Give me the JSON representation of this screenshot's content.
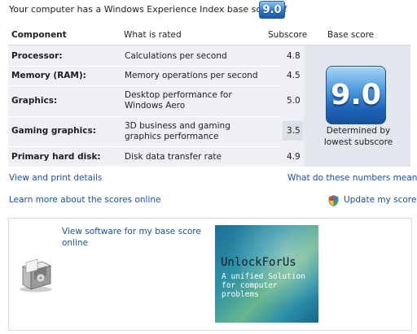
{
  "header": {
    "text": "Your computer has a Windows Experience Index base score of",
    "badge": "9.0"
  },
  "table": {
    "columns": [
      "Component",
      "What is rated",
      "Subscore",
      "Base score"
    ],
    "rows": [
      {
        "component": "Processor:",
        "rated": "Calculations per second",
        "subscore": "4.8"
      },
      {
        "component": "Memory (RAM):",
        "rated": "Memory operations per second",
        "subscore": "4.5"
      },
      {
        "component": "Graphics:",
        "rated": "Desktop performance for Windows Aero",
        "subscore": "5.0"
      },
      {
        "component": "Gaming graphics:",
        "rated": "3D business and gaming graphics performance",
        "subscore": "3.5"
      },
      {
        "component": "Primary hard disk:",
        "rated": "Disk data transfer rate",
        "subscore": "4.9"
      }
    ],
    "base_score": "9.0",
    "base_caption": "Determined by lowest subscore"
  },
  "links": {
    "view_print": "View and print details",
    "what_numbers": "What do these numbers mean?",
    "learn_more": "Learn more about the scores online",
    "update": "Update my score"
  },
  "software": {
    "link": "View software for my base score online",
    "ad_title": "UnlockForUs",
    "ad_subtitle": "A unified Solution for computer problems"
  },
  "icons": {
    "shield": "uac-shield-icon",
    "software_box": "software-box-icon"
  },
  "colors": {
    "link": "#1a4fa6",
    "badge": "#2f77c6",
    "row_band": "#eef0f5"
  }
}
